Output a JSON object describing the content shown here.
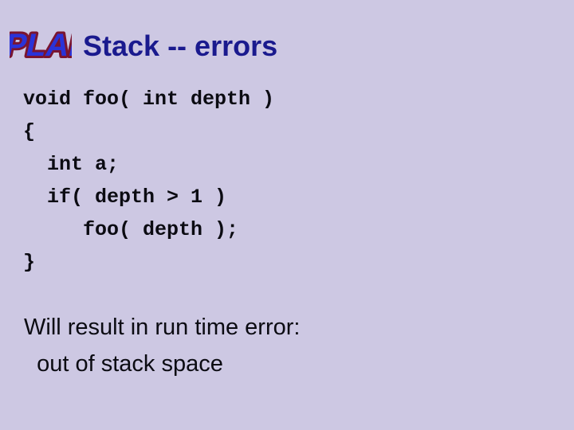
{
  "slide": {
    "background_color": "#cdc8e3",
    "title": "Stack -- errors",
    "title_color": "#1a1a8e"
  },
  "logo": {
    "name": "plab-logo",
    "text": "PLAB",
    "fill_color": "#2a33d8",
    "shadow_color": "#7a1530"
  },
  "code": {
    "text_color": "#0b0b12",
    "lines": [
      "void foo( int depth )",
      "{",
      "  int a;",
      "  if( depth > 1 )",
      "     foo( depth );",
      "}"
    ]
  },
  "conclusion": {
    "text_color": "#0b0b12",
    "lines": [
      "Will result in run time error:",
      "  out of stack space"
    ]
  }
}
